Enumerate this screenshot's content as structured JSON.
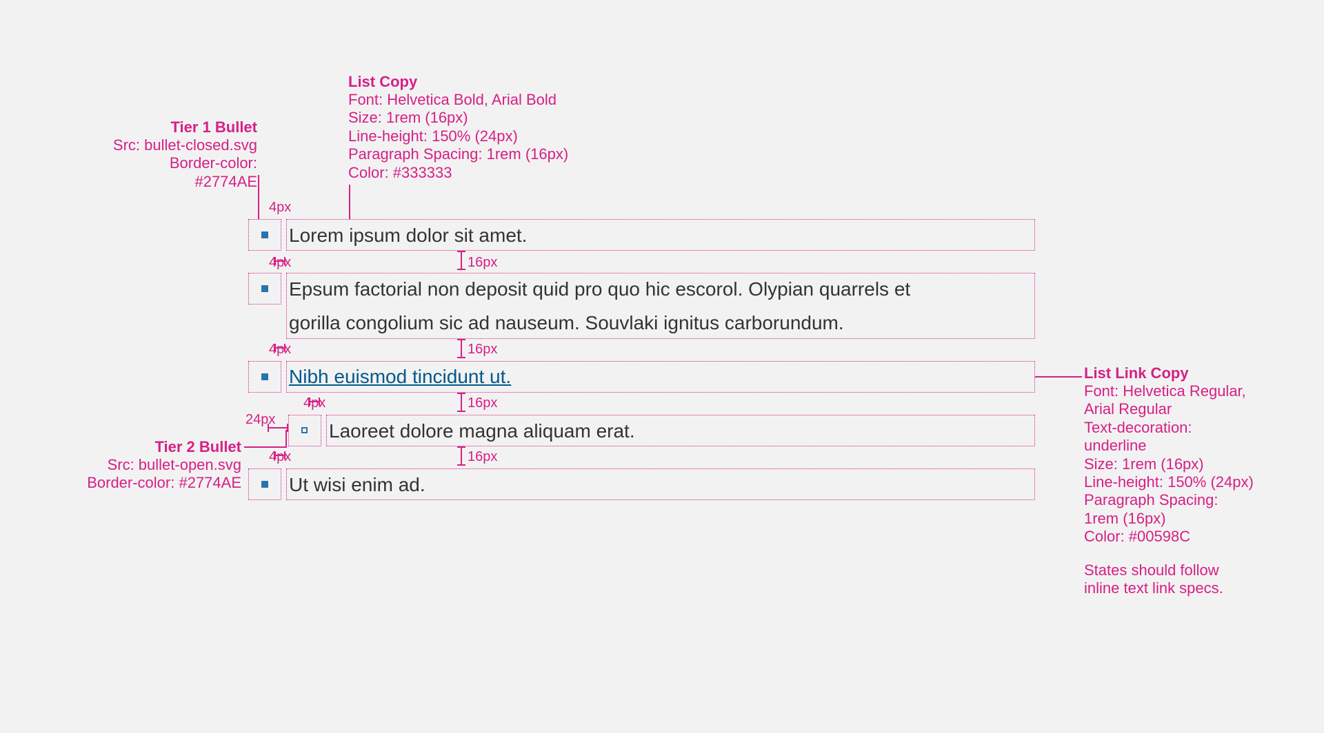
{
  "annotations": {
    "tier1": {
      "title": "Tier 1 Bullet",
      "src": "Src: bullet-closed.svg",
      "border": "Border-color: #2774AE"
    },
    "tier2": {
      "title": "Tier 2 Bullet",
      "src": "Src: bullet-open.svg",
      "border": "Border-color: #2774AE"
    },
    "listCopy": {
      "title": "List Copy",
      "line1": "Font: Helvetica Bold, Arial Bold",
      "line2": "Size: 1rem (16px)",
      "line3": "Line-height: 150% (24px)",
      "line4": "Paragraph Spacing: 1rem (16px)",
      "line5": "Color: #333333"
    },
    "listLink": {
      "title": "List Link Copy",
      "line1": "Font: Helvetica Regular,",
      "line2": "Arial Regular",
      "line3": "Text-decoration:",
      "line4": "underline",
      "line5": "Size: 1rem (16px)",
      "line6": "Line-height: 150% (24px)",
      "line7": "Paragraph Spacing:",
      "line8": "1rem (16px)",
      "line9": "Color: #00598C",
      "note1": "States should follow",
      "note2": "inline text link specs."
    }
  },
  "dims": {
    "d4px": "4px",
    "d16px": "16px",
    "d24px": "24px"
  },
  "list": {
    "item1": "Lorem ipsum dolor sit amet.",
    "item2line1": "Epsum factorial non deposit quid pro quo hic escorol. Olypian quarrels et",
    "item2line2": "gorilla congolium sic ad nauseum. Souvlaki ignitus carborundum.",
    "item3link": "Nibh euismod tincidunt ut.",
    "item4": "Laoreet dolore magna aliquam erat.",
    "item5": "Ut wisi enim ad."
  }
}
